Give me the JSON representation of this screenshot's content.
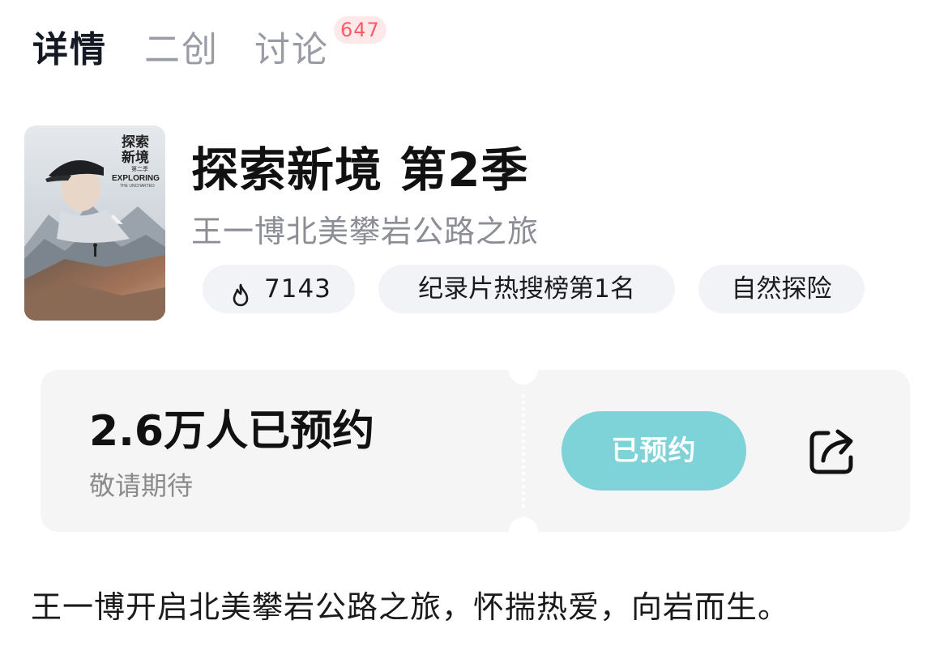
{
  "tabs": {
    "details": "详情",
    "remix": "二创",
    "discuss": "讨论",
    "discuss_badge": "647"
  },
  "poster": {
    "title_line1": "探索",
    "title_line2": "新境",
    "season": "第二季",
    "english": "EXPLORING",
    "english_sub": "THE UNCHARTED"
  },
  "show": {
    "title": "探索新境 第2季",
    "subtitle": "王一博北美攀岩公路之旅"
  },
  "chips": {
    "heat_icon": "flame-icon",
    "heat_value": "7143",
    "rank": "纪录片热搜榜第1名",
    "genre": "自然探险"
  },
  "reservation": {
    "count": "2.6万人已预约",
    "subtext": "敬请期待",
    "button": "已预约",
    "share_icon": "share-icon",
    "button_color": "#7dd3d8"
  },
  "description": "王一博开启北美攀岩公路之旅，怀揣热爱，向岩而生。",
  "colors": {
    "badge_bg": "#fde8ea",
    "badge_text": "#ff5a67",
    "chip_bg": "#f2f3f7",
    "card_bg": "#f5f5f5"
  }
}
